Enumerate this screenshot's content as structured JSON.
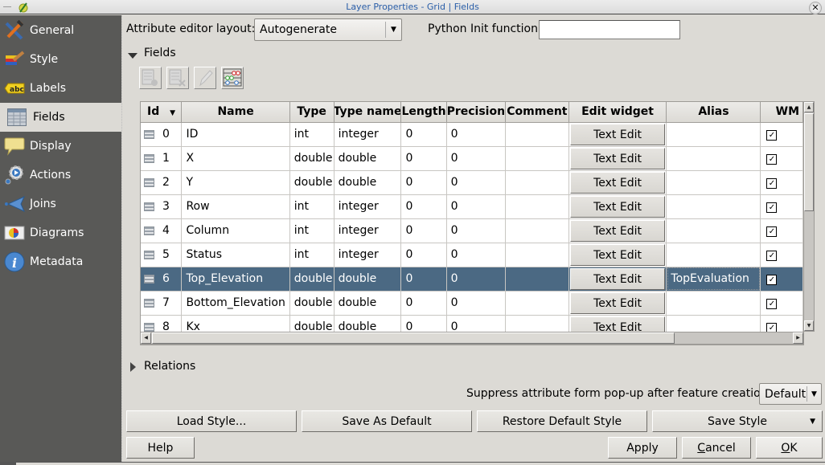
{
  "window": {
    "title": "Layer Properties - Grid | Fields",
    "close_glyph": "✕"
  },
  "sidebar": {
    "items": [
      {
        "label": "General",
        "icon": "hammer-screwdriver-icon",
        "active": false
      },
      {
        "label": "Style",
        "icon": "paintbrush-icon",
        "active": false
      },
      {
        "label": "Labels",
        "icon": "abc-label-icon",
        "active": false
      },
      {
        "label": "Fields",
        "icon": "table-icon",
        "active": true
      },
      {
        "label": "Display",
        "icon": "speech-bubble-icon",
        "active": false
      },
      {
        "label": "Actions",
        "icon": "gear-play-icon",
        "active": false
      },
      {
        "label": "Joins",
        "icon": "join-arrow-icon",
        "active": false
      },
      {
        "label": "Diagrams",
        "icon": "pie-chart-icon",
        "active": false
      },
      {
        "label": "Metadata",
        "icon": "info-icon",
        "active": false
      }
    ]
  },
  "top": {
    "layout_label": "Attribute editor layout:",
    "layout_value": "Autogenerate",
    "python_label": "Python Init function",
    "python_value": ""
  },
  "fields_section": {
    "title": "Fields",
    "toolbar": [
      {
        "name": "new-field-button",
        "icon": "new-field-icon",
        "enabled": false
      },
      {
        "name": "delete-field-button",
        "icon": "delete-field-icon",
        "enabled": false
      },
      {
        "name": "toggle-editing-button",
        "icon": "pencil-icon",
        "enabled": false
      },
      {
        "name": "field-calculator-button",
        "icon": "abacus-icon",
        "enabled": true
      }
    ],
    "columns": [
      "Id",
      "Name",
      "Type",
      "Type name",
      "Length",
      "Precision",
      "Comment",
      "Edit widget",
      "Alias",
      "WM"
    ],
    "sort_indicator": "▼",
    "rows": [
      {
        "id": "0",
        "name": "ID",
        "type": "int",
        "type_name": "integer",
        "length": "0",
        "precision": "0",
        "comment": "",
        "edit_widget": "Text Edit",
        "alias": "",
        "wm": true,
        "selected": false
      },
      {
        "id": "1",
        "name": "X",
        "type": "double",
        "type_name": "double",
        "length": "0",
        "precision": "0",
        "comment": "",
        "edit_widget": "Text Edit",
        "alias": "",
        "wm": true,
        "selected": false
      },
      {
        "id": "2",
        "name": "Y",
        "type": "double",
        "type_name": "double",
        "length": "0",
        "precision": "0",
        "comment": "",
        "edit_widget": "Text Edit",
        "alias": "",
        "wm": true,
        "selected": false
      },
      {
        "id": "3",
        "name": "Row",
        "type": "int",
        "type_name": "integer",
        "length": "0",
        "precision": "0",
        "comment": "",
        "edit_widget": "Text Edit",
        "alias": "",
        "wm": true,
        "selected": false
      },
      {
        "id": "4",
        "name": "Column",
        "type": "int",
        "type_name": "integer",
        "length": "0",
        "precision": "0",
        "comment": "",
        "edit_widget": "Text Edit",
        "alias": "",
        "wm": true,
        "selected": false
      },
      {
        "id": "5",
        "name": "Status",
        "type": "int",
        "type_name": "integer",
        "length": "0",
        "precision": "0",
        "comment": "",
        "edit_widget": "Text Edit",
        "alias": "",
        "wm": true,
        "selected": false
      },
      {
        "id": "6",
        "name": "Top_Elevation",
        "type": "double",
        "type_name": "double",
        "length": "0",
        "precision": "0",
        "comment": "",
        "edit_widget": "Text Edit",
        "alias": "TopEvaluation",
        "wm": true,
        "selected": true
      },
      {
        "id": "7",
        "name": "Bottom_Elevation",
        "type": "double",
        "type_name": "double",
        "length": "0",
        "precision": "0",
        "comment": "",
        "edit_widget": "Text Edit",
        "alias": "",
        "wm": true,
        "selected": false
      },
      {
        "id": "8",
        "name": "Kx",
        "type": "double",
        "type_name": "double",
        "length": "0",
        "precision": "0",
        "comment": "",
        "edit_widget": "Text Edit",
        "alias": "",
        "wm": true,
        "selected": false
      }
    ]
  },
  "relations_section": {
    "title": "Relations"
  },
  "suppress": {
    "label": "Suppress attribute form pop-up after feature creation",
    "value": "Default"
  },
  "style_buttons": {
    "load": "Load Style...",
    "save_default": "Save As Default",
    "restore_default": "Restore Default Style",
    "save_style": "Save Style"
  },
  "dialog_buttons": {
    "help": "Help",
    "apply": "Apply",
    "cancel_first": "C",
    "cancel_rest": "ancel",
    "ok_first": "O",
    "ok_rest": "K"
  }
}
